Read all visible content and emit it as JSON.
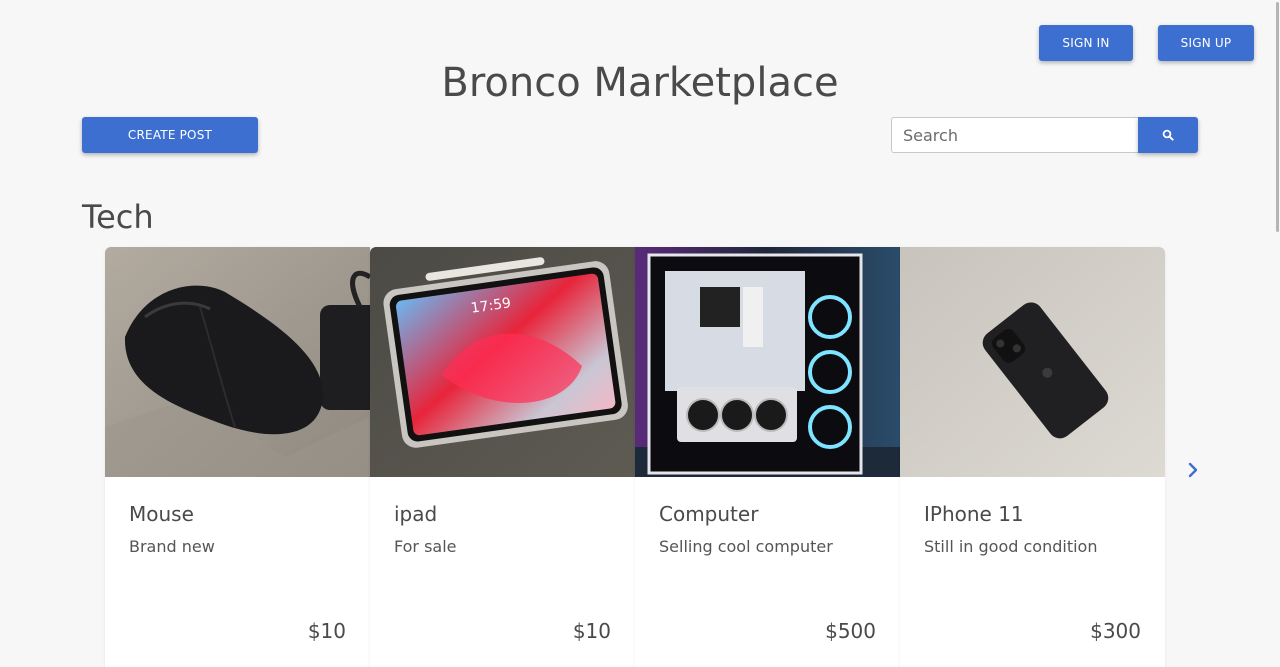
{
  "header": {
    "sign_in": "SIGN IN",
    "sign_up": "SIGN UP",
    "title": "Bronco Marketplace",
    "create_post": "CREATE POST",
    "search_placeholder": "Search"
  },
  "section": {
    "title": "Tech"
  },
  "cards": [
    {
      "name": "Mouse",
      "desc": "Brand new",
      "price": "$10"
    },
    {
      "name": "ipad",
      "desc": "For sale",
      "price": "$10"
    },
    {
      "name": "Computer",
      "desc": "Selling cool computer",
      "price": "$500"
    },
    {
      "name": "IPhone 11",
      "desc": "Still in good condition",
      "price": "$300"
    }
  ],
  "ipad_screen_time": "17:59",
  "colors": {
    "accent": "#3d6fd1",
    "background": "#f7f7f7"
  },
  "icons": {
    "search": "search-icon",
    "next": "chevron-right-icon"
  }
}
